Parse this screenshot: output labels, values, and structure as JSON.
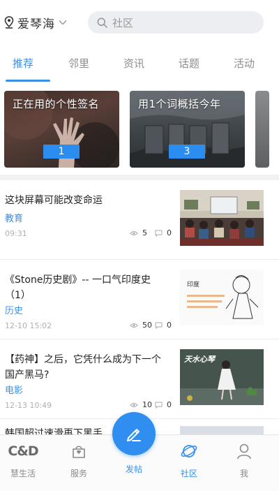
{
  "header": {
    "location": "爱琴海",
    "search_placeholder": "社区"
  },
  "tabs": [
    {
      "label": "推荐",
      "active": true
    },
    {
      "label": "邻里",
      "active": false
    },
    {
      "label": "资讯",
      "active": false
    },
    {
      "label": "话题",
      "active": false
    },
    {
      "label": "活动",
      "active": false
    }
  ],
  "cards": [
    {
      "title": "正在用的个性签名",
      "badge": "1"
    },
    {
      "title": "用1个词概括今年",
      "badge": "3"
    }
  ],
  "articles": [
    {
      "title": "这块屏幕可能改变命运",
      "category": "教育",
      "time": "09:31",
      "views": "5",
      "comments": "0"
    },
    {
      "title": "《Stone历史剧》-- 一口气印度史（1）",
      "category": "历史",
      "time": "12-10 15:02",
      "views": "50",
      "comments": "0"
    },
    {
      "title": "【药神】之后，它凭什么成为下一个国产黑马?",
      "category": "电影",
      "time": "12-13 10:49",
      "views": "10",
      "comments": "0"
    },
    {
      "title": "韩国超过速滑再下黑手"
    }
  ],
  "thumbs": {
    "thumb2_text1": "印度",
    "thumb3_text": "天水心琴"
  },
  "bottom_nav": {
    "life_logo": "C&D",
    "life": "慧生活",
    "service": "服务",
    "post": "发帖",
    "community": "社区",
    "me": "我"
  },
  "colors": {
    "accent": "#3a8fe8",
    "fab": "#2f8ef0",
    "badge": "#2c8df0"
  }
}
